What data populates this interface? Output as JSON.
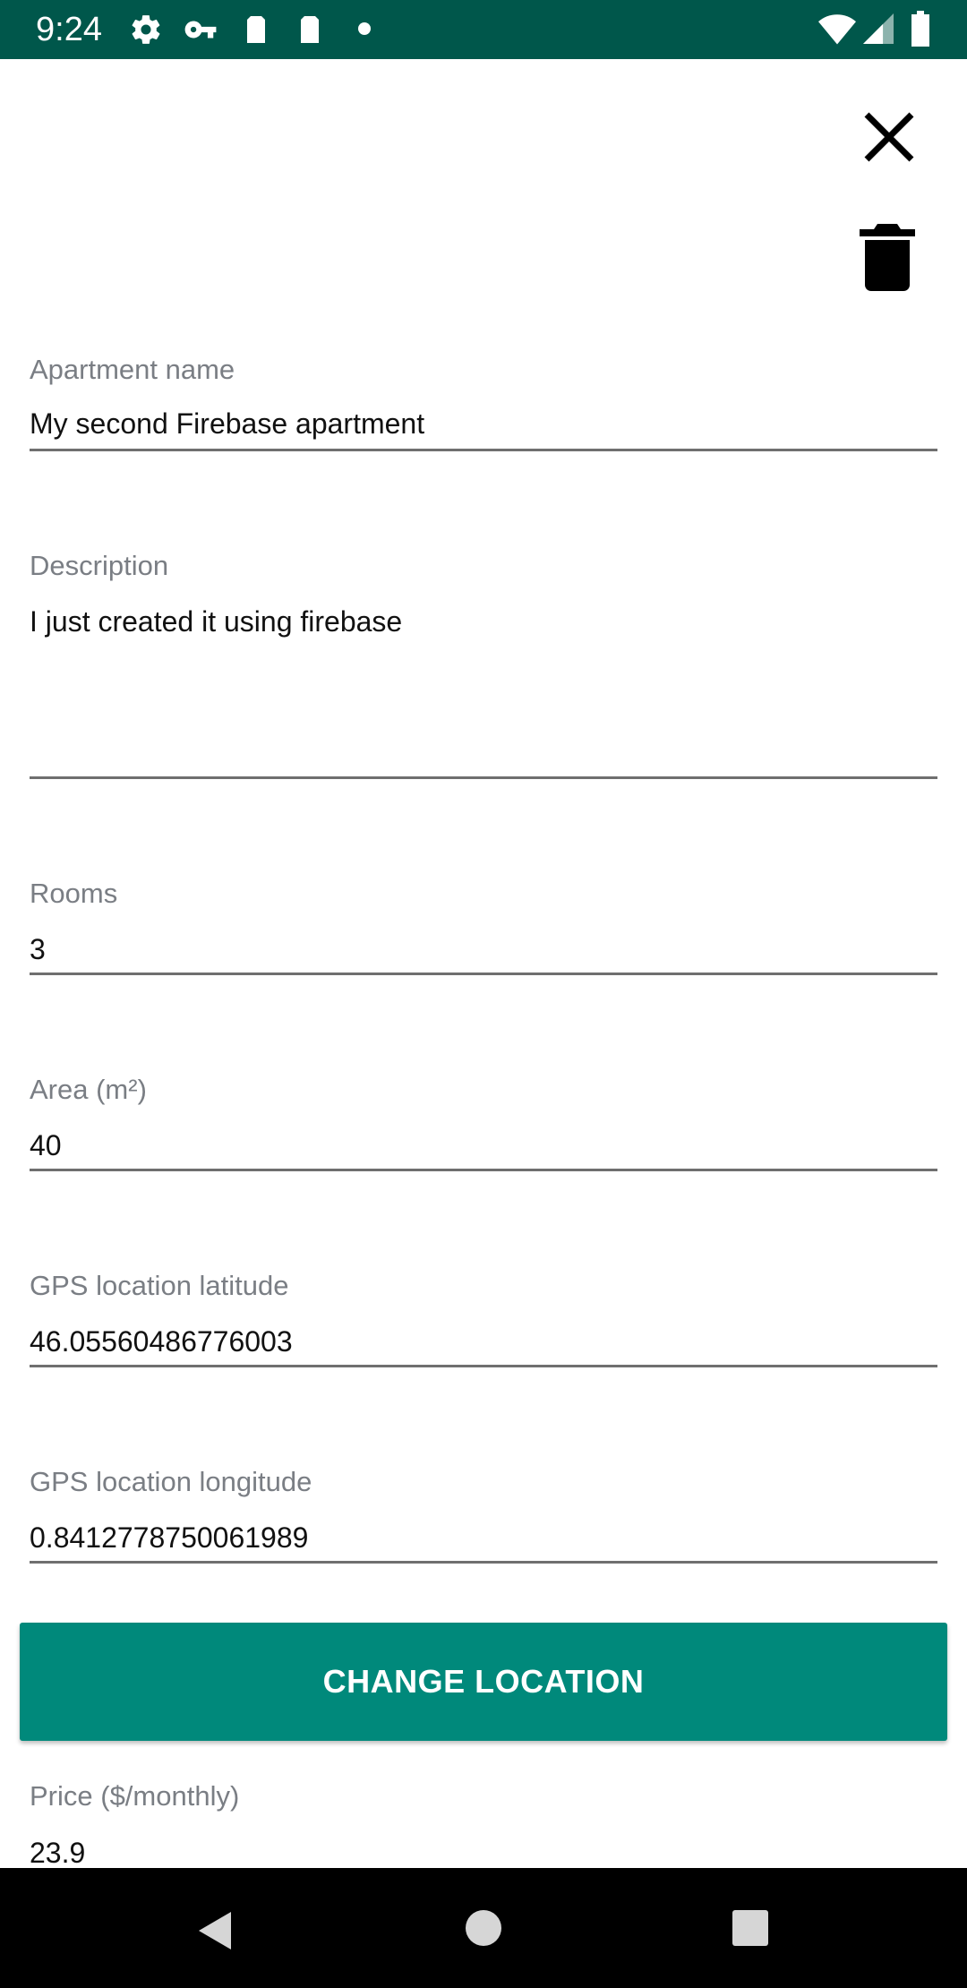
{
  "status_bar": {
    "time": "9:24",
    "icons": [
      "gear-icon",
      "key-icon",
      "sim-card-icon",
      "sim-card-icon",
      "dot-icon",
      "wifi-icon",
      "signal-icon",
      "battery-icon"
    ]
  },
  "toolbar": {
    "close_icon": "close-icon",
    "delete_icon": "trash-icon"
  },
  "form": {
    "apartment_name": {
      "label": "Apartment name",
      "value": "My second Firebase apartment"
    },
    "description": {
      "label": "Description",
      "value": "I just created it using firebase"
    },
    "rooms": {
      "label": "Rooms",
      "value": "3"
    },
    "area": {
      "label": "Area (m²)",
      "value": "40"
    },
    "latitude": {
      "label": "GPS location latitude",
      "value": "46.05560486776003"
    },
    "longitude": {
      "label": "GPS location longitude",
      "value": "0.8412778750061989"
    },
    "change_location_label": "CHANGE LOCATION",
    "price": {
      "label": "Price ($/monthly)",
      "value": "23.9"
    }
  },
  "nav_bar": {
    "back_icon": "back-triangle-icon",
    "home_icon": "home-circle-icon",
    "recents_icon": "recents-square-icon"
  },
  "colors": {
    "status_bar": "#00574b",
    "accent": "#00897b",
    "label": "#7a7e84",
    "nav_bar": "#000000"
  }
}
